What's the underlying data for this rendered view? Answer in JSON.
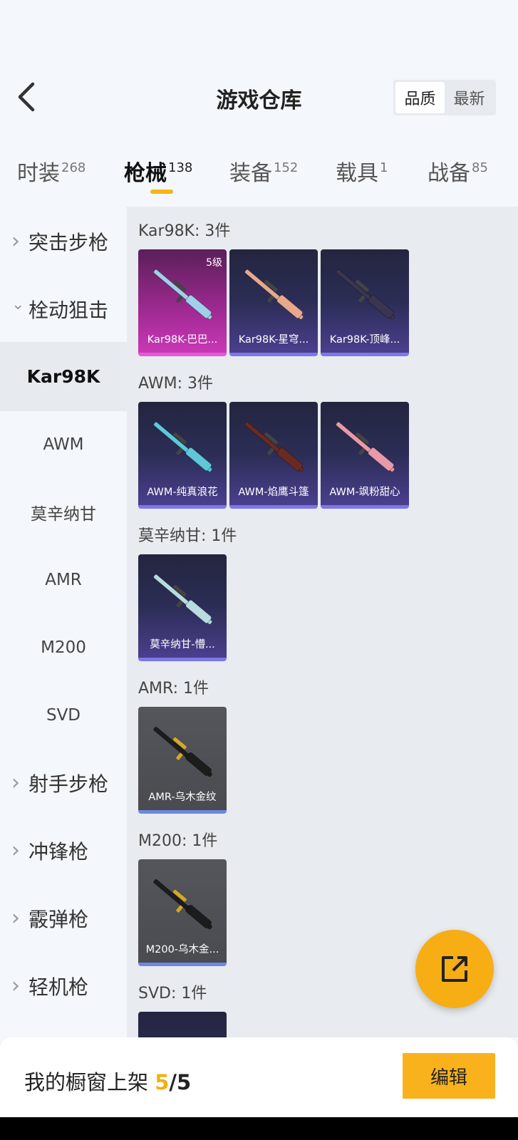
{
  "header": {
    "title": "游戏仓库",
    "sort_options": [
      "品质",
      "最新"
    ],
    "active_sort": "品质"
  },
  "tabs": [
    {
      "label": "时装",
      "count": "268"
    },
    {
      "label": "枪械",
      "count": "138"
    },
    {
      "label": "装备",
      "count": "152"
    },
    {
      "label": "载具",
      "count": "1"
    },
    {
      "label": "战备",
      "count": "85"
    }
  ],
  "active_tab": "枪械",
  "sidebar": {
    "items": [
      {
        "label": "突击步枪",
        "type": "category",
        "expanded": false
      },
      {
        "label": "栓动狙击",
        "type": "category",
        "expanded": true
      },
      {
        "label": "Kar98K",
        "type": "sub",
        "active": true
      },
      {
        "label": "AWM",
        "type": "sub"
      },
      {
        "label": "莫辛纳甘",
        "type": "sub"
      },
      {
        "label": "AMR",
        "type": "sub"
      },
      {
        "label": "M200",
        "type": "sub"
      },
      {
        "label": "SVD",
        "type": "sub"
      },
      {
        "label": "射手步枪",
        "type": "category",
        "expanded": false
      },
      {
        "label": "冲锋枪",
        "type": "category",
        "expanded": false
      },
      {
        "label": "霰弹枪",
        "type": "category",
        "expanded": false
      },
      {
        "label": "轻机枪",
        "type": "category",
        "expanded": false
      }
    ]
  },
  "groups": [
    {
      "title": "Kar98K: 3件",
      "items": [
        {
          "name": "Kar98K-巴巴...",
          "level": "5级",
          "style": "pink",
          "gun_color": "#9fd0e8"
        },
        {
          "name": "Kar98K-星穹...",
          "style": "purple",
          "gun_color": "#e8a88c"
        },
        {
          "name": "Kar98K-顶峰...",
          "style": "purple",
          "gun_color": "#3a3550"
        }
      ]
    },
    {
      "title": "AWM: 3件",
      "items": [
        {
          "name": "AWM-纯真浪花",
          "style": "purple",
          "gun_color": "#5ec8d8"
        },
        {
          "name": "AWM-焰鹰斗篷",
          "style": "purple",
          "gun_color": "#6a2a22"
        },
        {
          "name": "AWM-飒粉甜心",
          "style": "purple",
          "gun_color": "#e89aa8"
        }
      ]
    },
    {
      "title": "莫辛纳甘: 1件",
      "items": [
        {
          "name": "莫辛纳甘-懵...",
          "style": "purple",
          "gun_color": "#b8dce0"
        }
      ]
    },
    {
      "title": "AMR: 1件",
      "items": [
        {
          "name": "AMR-乌木金纹",
          "style": "gray",
          "gun_color": "#1c1c1c"
        }
      ]
    },
    {
      "title": "M200: 1件",
      "items": [
        {
          "name": "M200-乌木金...",
          "style": "gray",
          "gun_color": "#1c1c1c"
        }
      ]
    },
    {
      "title": "SVD: 1件",
      "items": []
    }
  ],
  "footer": {
    "label": "我的橱窗上架",
    "current": "5",
    "separator": "/",
    "total": "5",
    "edit_label": "编辑"
  },
  "colors": {
    "accent": "#f6b416",
    "fab": "#f6ae14"
  }
}
